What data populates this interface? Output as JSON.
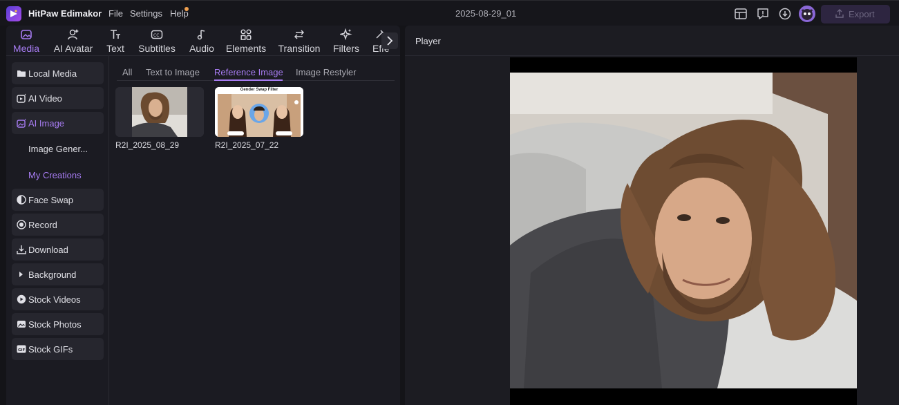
{
  "app": {
    "name": "HitPaw Edimakor",
    "doc_title": "2025-08-29_01"
  },
  "menu": {
    "file": "File",
    "settings": "Settings",
    "help": "Help"
  },
  "toolbar": {
    "export_label": "Export"
  },
  "tabs": [
    {
      "label": "Media",
      "icon": "media-icon"
    },
    {
      "label": "AI Avatar",
      "icon": "ai-avatar-icon"
    },
    {
      "label": "Text",
      "icon": "text-icon"
    },
    {
      "label": "Subtitles",
      "icon": "subtitles-icon"
    },
    {
      "label": "Audio",
      "icon": "audio-icon"
    },
    {
      "label": "Elements",
      "icon": "elements-icon"
    },
    {
      "label": "Transition",
      "icon": "transition-icon"
    },
    {
      "label": "Filters",
      "icon": "filters-icon"
    },
    {
      "label": "Effe",
      "icon": "effects-icon"
    }
  ],
  "sidebar": {
    "items": [
      {
        "label": "Local Media"
      },
      {
        "label": "AI Video"
      },
      {
        "label": "AI Image"
      },
      {
        "label": "Image Gener..."
      },
      {
        "label": "My Creations"
      },
      {
        "label": "Face Swap"
      },
      {
        "label": "Record"
      },
      {
        "label": "Download"
      },
      {
        "label": "Background"
      },
      {
        "label": "Stock Videos"
      },
      {
        "label": "Stock Photos"
      },
      {
        "label": "Stock GIFs"
      }
    ]
  },
  "subtabs": [
    {
      "label": "All"
    },
    {
      "label": "Text to Image"
    },
    {
      "label": "Reference Image"
    },
    {
      "label": "Image Restyler"
    }
  ],
  "media": [
    {
      "label": "R2I_2025_08_29"
    },
    {
      "label": "R2I_2025_07_22",
      "caption": "Gender Swap Filter"
    }
  ],
  "player": {
    "title": "Player"
  },
  "colors": {
    "accent": "#a77cf2",
    "background": "#141418",
    "panel": "#1b1b22"
  }
}
